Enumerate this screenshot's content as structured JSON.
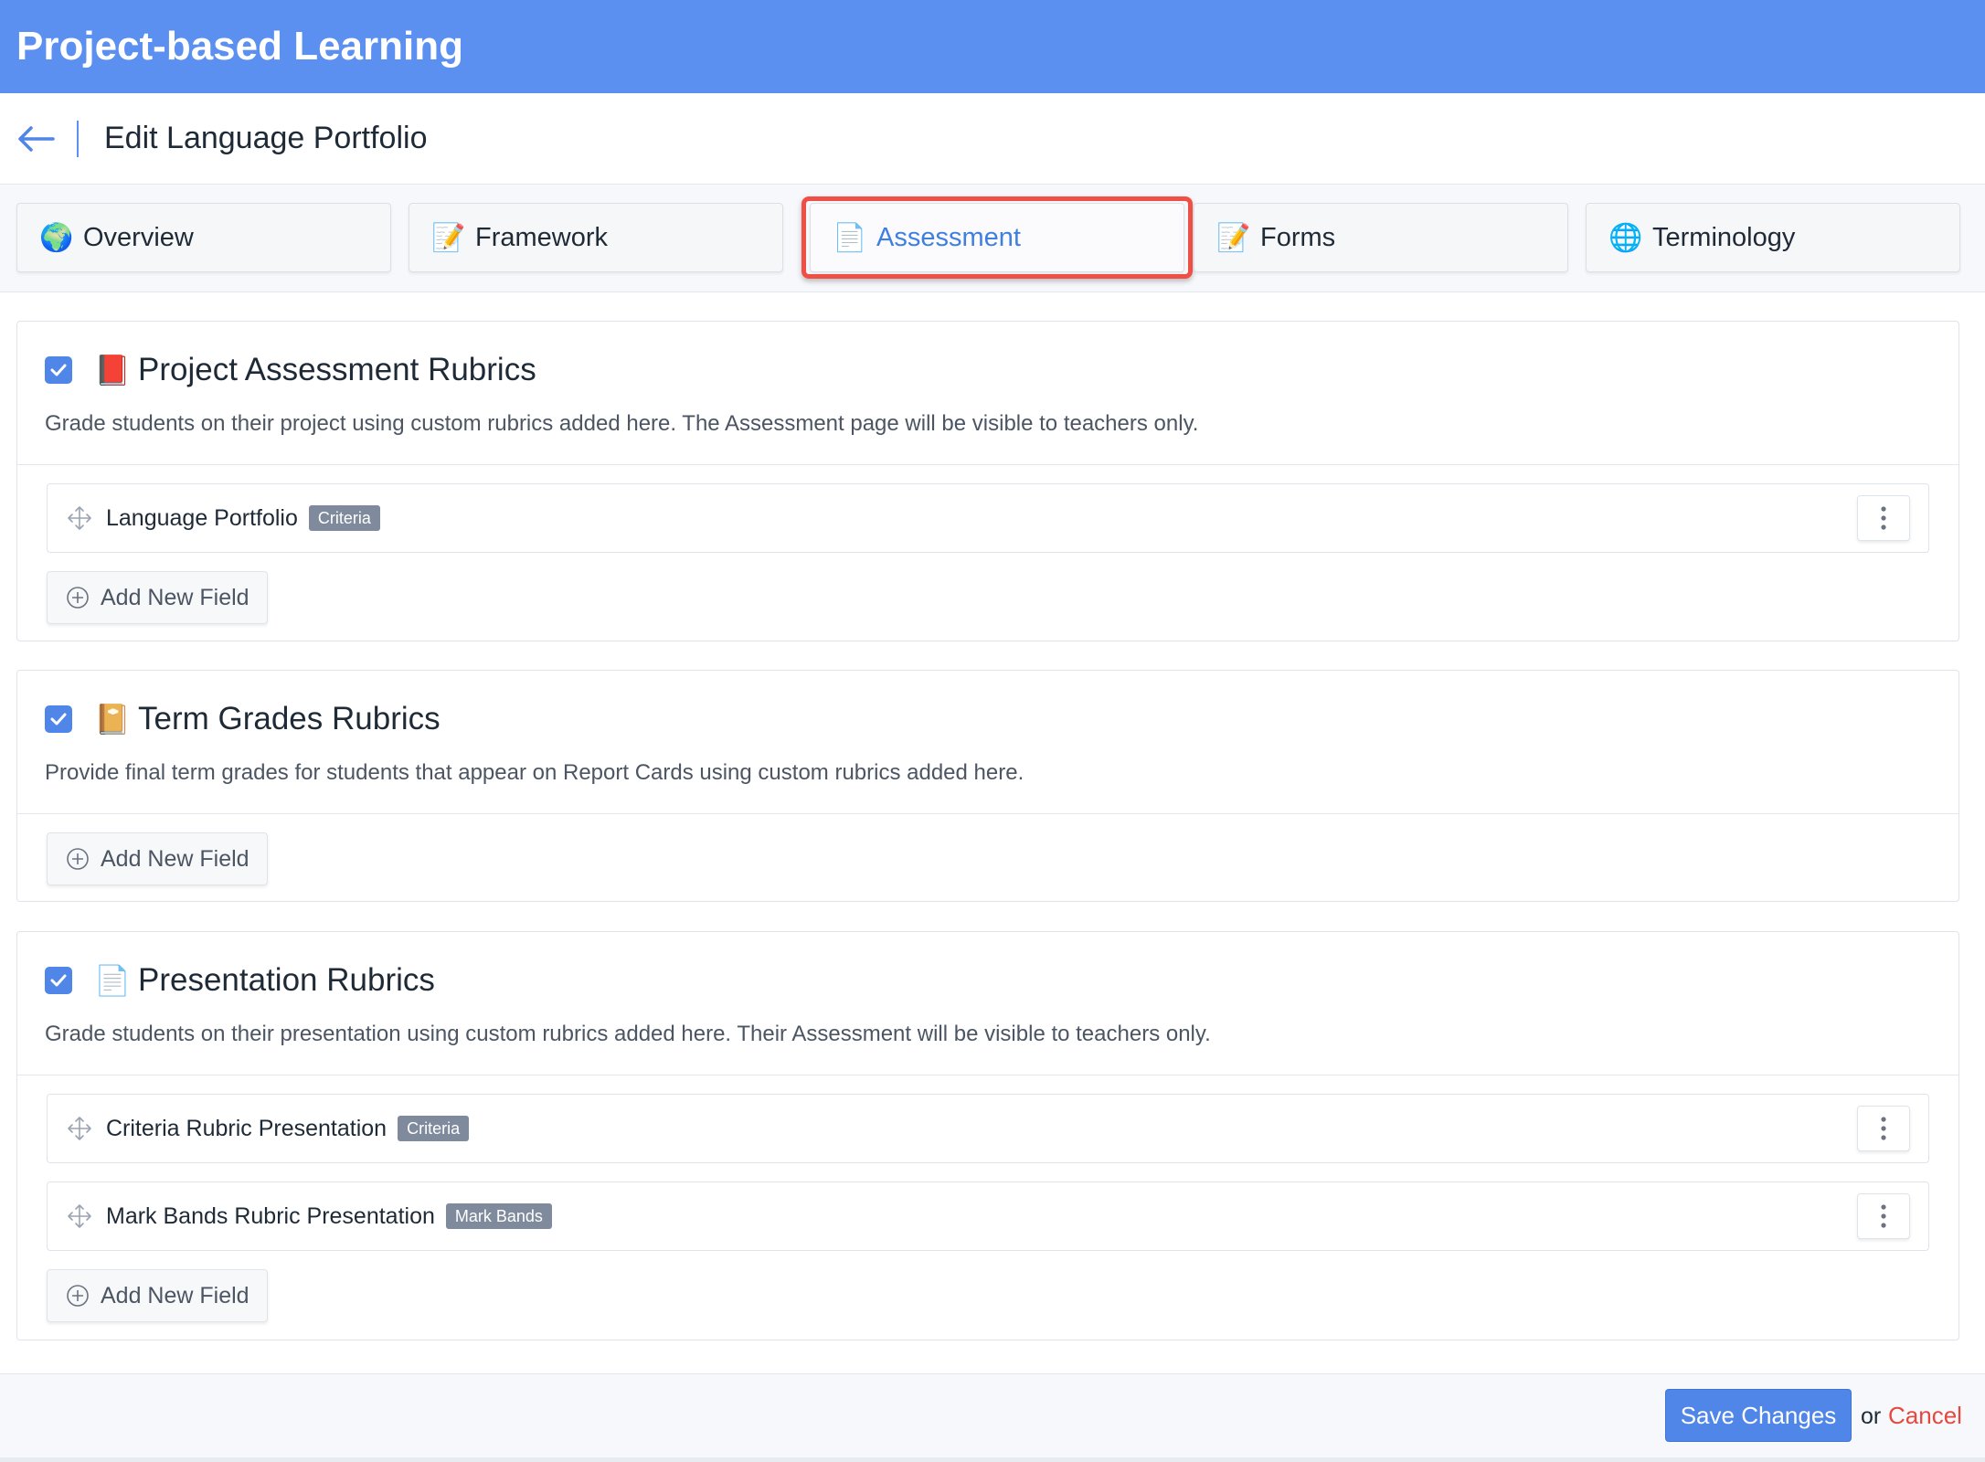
{
  "app": {
    "title": "Project-based Learning"
  },
  "page": {
    "title": "Edit Language Portfolio"
  },
  "tabs": [
    {
      "label": "Overview",
      "emoji": "🌍",
      "active": false
    },
    {
      "label": "Framework",
      "emoji": "📝",
      "active": false
    },
    {
      "label": "Assessment",
      "emoji": "📄",
      "active": true
    },
    {
      "label": "Forms",
      "emoji": "📝",
      "active": false
    },
    {
      "label": "Terminology",
      "emoji": "🌐",
      "active": false
    }
  ],
  "sections": [
    {
      "emoji": "📕",
      "title": "Project Assessment Rubrics",
      "checked": true,
      "description": "Grade students on their project using custom rubrics added here. The Assessment page will be visible to teachers only.",
      "fields": [
        {
          "name": "Language Portfolio",
          "badge": "Criteria"
        }
      ],
      "add_label": "Add New Field"
    },
    {
      "emoji": "📔",
      "title": "Term Grades Rubrics",
      "checked": true,
      "description": "Provide final term grades for students that appear on Report Cards using custom rubrics added here.",
      "fields": [],
      "add_label": "Add New Field"
    },
    {
      "emoji": "📄",
      "title": "Presentation Rubrics",
      "checked": true,
      "description": "Grade students on their presentation using custom rubrics added here. Their Assessment will be visible to teachers only.",
      "fields": [
        {
          "name": "Criteria Rubric Presentation",
          "badge": "Criteria"
        },
        {
          "name": "Mark Bands Rubric Presentation",
          "badge": "Mark Bands"
        }
      ],
      "add_label": "Add New Field"
    }
  ],
  "footer": {
    "save_label": "Save Changes",
    "or_text": "or",
    "cancel_label": "Cancel"
  },
  "colors": {
    "header_bg": "#5b8ff0",
    "accent": "#4f86e8",
    "active_tab_text": "#3f7fe0",
    "highlight": "#ef4f45",
    "cancel": "#e5483f",
    "badge": "#7f8a9c"
  }
}
